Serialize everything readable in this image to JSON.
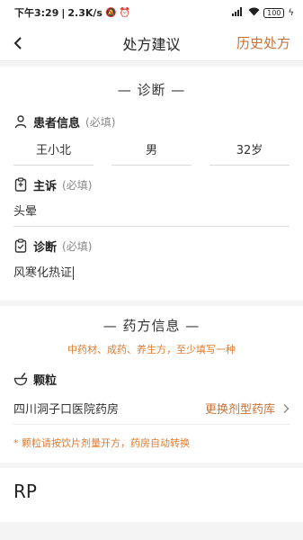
{
  "status_bar": {
    "time": "下午3:29",
    "speed": "2.3K/s",
    "signal": "4G",
    "battery": "100"
  },
  "nav": {
    "title": "处方建议",
    "right_link": "历史处方"
  },
  "diagnosis": {
    "section_title": "— 诊断 —",
    "patient": {
      "label": "患者信息",
      "required": "(必填)",
      "name": "王小北",
      "gender": "男",
      "age": "32岁"
    },
    "complaint": {
      "label": "主诉",
      "required": "(必填)",
      "value": "头晕"
    },
    "diag": {
      "label": "诊断",
      "required": "(必填)",
      "value": "风寒化热证"
    }
  },
  "prescription": {
    "section_title": "— 药方信息 —",
    "hint": "中药材、成药、养生方，至少填写一种",
    "granule_label": "颗粒",
    "pharmacy_name": "四川洞子口医院药房",
    "switch_label": "更换剂型药库",
    "note": "* 颗粒请按饮片剂量开方，药房自动转换"
  },
  "rp": {
    "label": "RP"
  },
  "colors": {
    "accent": "#c7733a",
    "hint": "#e07a2f"
  }
}
